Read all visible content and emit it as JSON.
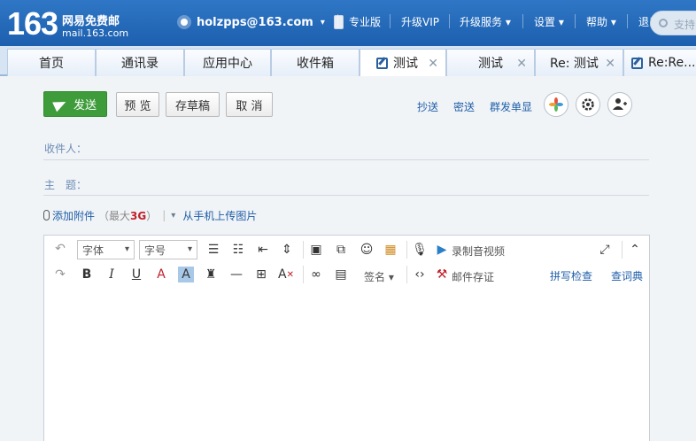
{
  "header": {
    "logo_number": "163",
    "logo_cn": "网易免费邮",
    "logo_url": "mail.163.com",
    "user_email": "holzpps@163.com",
    "links": [
      "专业版",
      "升级VIP",
      "升级服务",
      "设置",
      "帮助",
      "退出"
    ],
    "search_placeholder": "支持"
  },
  "tabs": [
    {
      "label": "首页"
    },
    {
      "label": "通讯录"
    },
    {
      "label": "应用中心"
    },
    {
      "label": "收件箱"
    },
    {
      "label": "测试"
    },
    {
      "label": "测试"
    },
    {
      "label": "Re: 测试"
    },
    {
      "label": "Re:Re..."
    }
  ],
  "toolbar": {
    "send_label": "发送",
    "preview_label": "预 览",
    "draft_label": "存草稿",
    "cancel_label": "取 消",
    "cc_label": "抄送",
    "bcc_label": "密送",
    "group_single_label": "群发单显"
  },
  "fields": {
    "recipient_label": "收件人：",
    "subject_label": "主　题："
  },
  "attach": {
    "add_label": "添加附件",
    "max_open": "（最大",
    "max_size": "3G",
    "max_close": "）",
    "mobile_upload_label": "从手机上传图片"
  },
  "editor": {
    "font_placeholder": "字体",
    "size_placeholder": "字号",
    "record_label": "录制音视频",
    "signature_label": "签名",
    "certify_label": "邮件存证",
    "spellcheck_label": "拼写检查",
    "dictionary_label": "查词典"
  },
  "colors": {
    "header_blue": "#1c5fae",
    "send_green": "#3e9c3b",
    "link_blue": "#1f5ea8"
  }
}
